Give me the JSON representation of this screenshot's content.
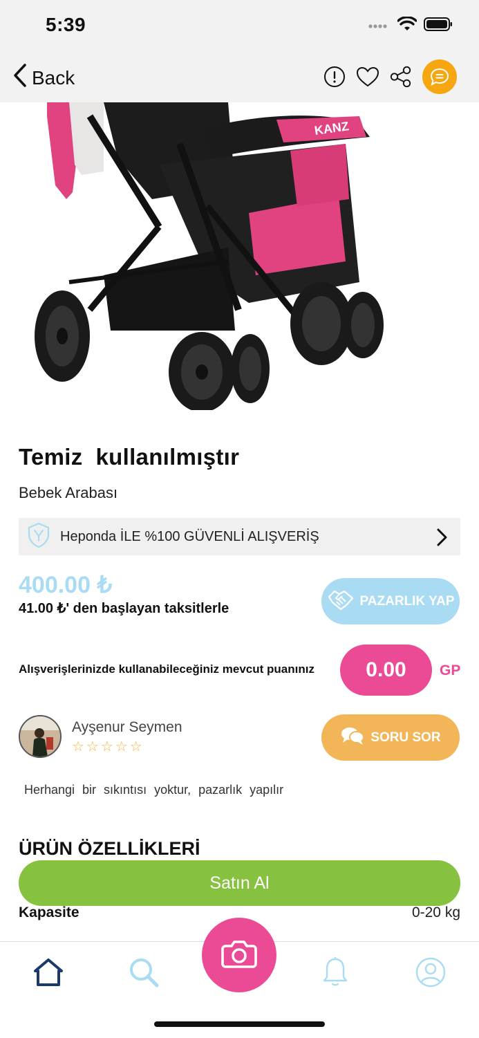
{
  "status_bar": {
    "time": "5:39"
  },
  "nav": {
    "back_label": "Back",
    "icons": [
      "report-icon",
      "heart-icon",
      "share-icon",
      "chat-icon"
    ]
  },
  "product": {
    "image_brand_text": "KANZ",
    "title": "Temiz  kullanılmıştır",
    "category": "Bebek Arabası",
    "secure_text": "Heponda İLE %100 GÜVENLİ ALIŞVERİŞ",
    "price": "400.00 ₺",
    "installment_text": "41.00 ₺'  den başlayan taksitlerle",
    "bargain_label": "PAZARLIK YAP"
  },
  "points": {
    "label": "Alışverişlerinizde kullanabileceğiniz mevcut puanınız",
    "value": "0.00",
    "unit": "GP"
  },
  "seller": {
    "name": "Ayşenur Seymen",
    "rating": 0,
    "stars_display": "☆☆☆☆☆",
    "ask_label": "SORU SOR"
  },
  "description": "Herhangi bir sıkıntısı yoktur, pazarlık yapılır",
  "features": {
    "heading": "ÜRÜN ÖZELLİKLERİ",
    "items": [
      {
        "label": "Kapasite",
        "value": "0-20 kg"
      }
    ]
  },
  "buy_label": "Satın Al",
  "tabbar": {
    "tabs": [
      "home-icon",
      "search-icon",
      "camera-icon",
      "bell-icon",
      "profile-icon"
    ]
  },
  "colors": {
    "accent_pink": "#eb4a95",
    "light_blue": "#a9dbf3",
    "orange": "#f2b659",
    "green": "#86c140",
    "nav_orange": "#f6a60e"
  }
}
